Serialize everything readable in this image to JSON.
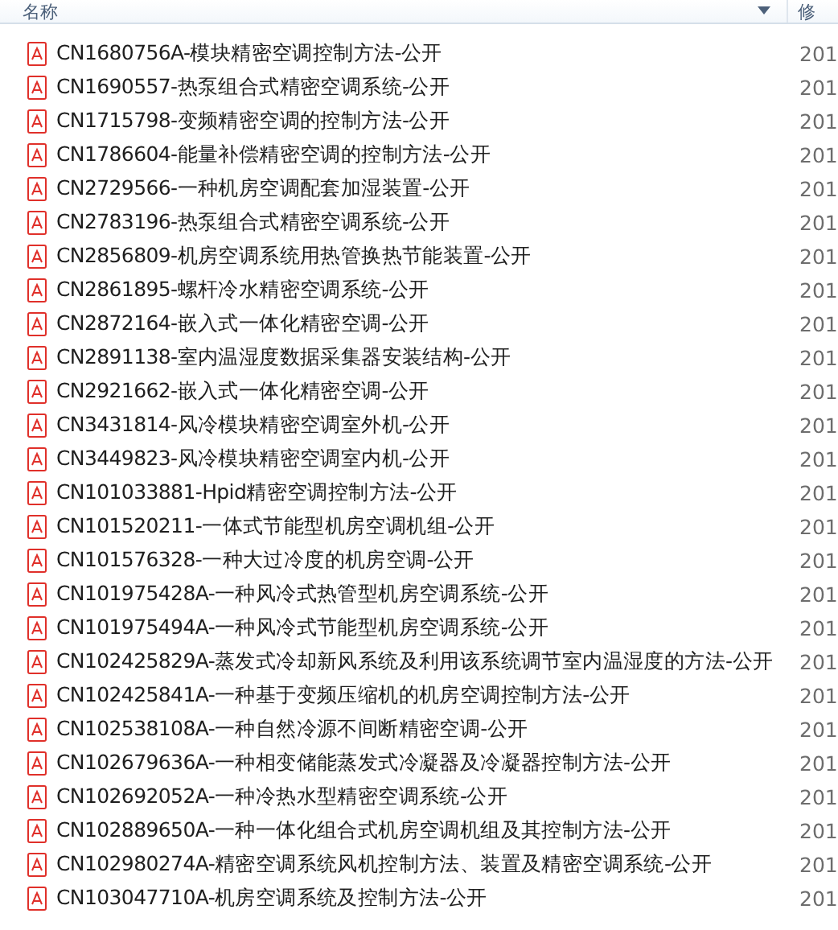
{
  "columns": [
    "名称",
    "修"
  ],
  "files": [
    {
      "name": "CN1680756A-模块精密空调控制方法-公开",
      "modified": "201"
    },
    {
      "name": "CN1690557-热泵组合式精密空调系统-公开",
      "modified": "201"
    },
    {
      "name": "CN1715798-变频精密空调的控制方法-公开",
      "modified": "201"
    },
    {
      "name": "CN1786604-能量补偿精密空调的控制方法-公开",
      "modified": "201"
    },
    {
      "name": "CN2729566-一种机房空调配套加湿装置-公开",
      "modified": "201"
    },
    {
      "name": "CN2783196-热泵组合式精密空调系统-公开",
      "modified": "201"
    },
    {
      "name": "CN2856809-机房空调系统用热管换热节能装置-公开",
      "modified": "201"
    },
    {
      "name": "CN2861895-螺杆冷水精密空调系统-公开",
      "modified": "201"
    },
    {
      "name": "CN2872164-嵌入式一体化精密空调-公开",
      "modified": "201"
    },
    {
      "name": "CN2891138-室内温湿度数据采集器安装结构-公开",
      "modified": "201"
    },
    {
      "name": "CN2921662-嵌入式一体化精密空调-公开",
      "modified": "201"
    },
    {
      "name": "CN3431814-风冷模块精密空调室外机-公开",
      "modified": "201"
    },
    {
      "name": "CN3449823-风冷模块精密空调室内机-公开",
      "modified": "201"
    },
    {
      "name": "CN101033881-Hpid精密空调控制方法-公开",
      "modified": "201"
    },
    {
      "name": "CN101520211-一体式节能型机房空调机组-公开",
      "modified": "201"
    },
    {
      "name": "CN101576328-一种大过冷度的机房空调-公开",
      "modified": "201"
    },
    {
      "name": "CN101975428A-一种风冷式热管型机房空调系统-公开",
      "modified": "201"
    },
    {
      "name": "CN101975494A-一种风冷式节能型机房空调系统-公开",
      "modified": "201"
    },
    {
      "name": "CN102425829A-蒸发式冷却新风系统及利用该系统调节室内温湿度的方法-公开",
      "modified": "201"
    },
    {
      "name": "CN102425841A-一种基于变频压缩机的机房空调控制方法-公开",
      "modified": "201"
    },
    {
      "name": "CN102538108A-一种自然冷源不间断精密空调-公开",
      "modified": "201"
    },
    {
      "name": "CN102679636A-一种相变储能蒸发式冷凝器及冷凝器控制方法-公开",
      "modified": "201"
    },
    {
      "name": "CN102692052A-一种冷热水型精密空调系统-公开",
      "modified": "201"
    },
    {
      "name": "CN102889650A-一种一体化组合式机房空调机组及其控制方法-公开",
      "modified": "201"
    },
    {
      "name": "CN102980274A-精密空调系统风机控制方法、装置及精密空调系统-公开",
      "modified": "201"
    },
    {
      "name": "CN103047710A-机房空调系统及控制方法-公开",
      "modified": "201"
    }
  ]
}
